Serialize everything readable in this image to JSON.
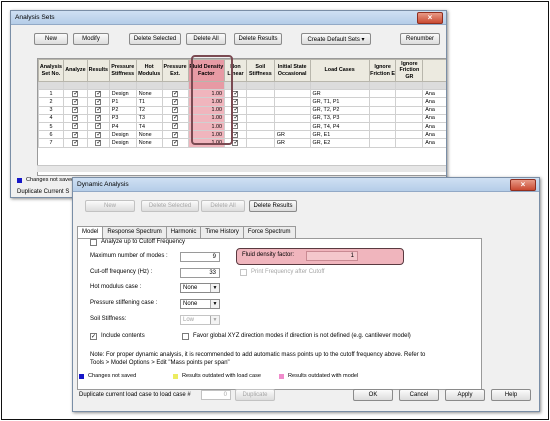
{
  "analysis_sets": {
    "title": "Analysis Sets",
    "close_symbol": "×",
    "toolbar": {
      "new": "New",
      "modify": "Modify",
      "delete_selected": "Delete Selected",
      "delete_all": "Delete All",
      "delete_results": "Delete Results",
      "create_default_sets": "Create Default Sets ▾",
      "renumber": "Renumber"
    },
    "columns": [
      "Analysis Set No.",
      "Analyze",
      "Results",
      "Pressure Stiffness",
      "Hot Modulus",
      "Pressure Ext.",
      "Fluid Density Factor",
      "Non Linear",
      "Soil Stiffness",
      "Initial State Occasional",
      "Load Cases",
      "Ignore Friction E",
      "Ignore Friction GR",
      ""
    ],
    "rows": [
      [
        "1",
        "✓",
        "✓",
        "Design",
        "None",
        "✓",
        "1.00",
        "✓",
        "",
        "",
        "GR",
        "",
        "",
        "Ana"
      ],
      [
        "2",
        "✓",
        "✓",
        "P1",
        "T1",
        "✓",
        "1.00",
        "✓",
        "",
        "",
        "GR, T1, P1",
        "",
        "",
        "Ana"
      ],
      [
        "3",
        "✓",
        "✓",
        "P2",
        "T2",
        "✓",
        "1.00",
        "✓",
        "",
        "",
        "GR, T2, P2",
        "",
        "",
        "Ana"
      ],
      [
        "4",
        "✓",
        "✓",
        "P3",
        "T3",
        "✓",
        "1.00",
        "✓",
        "",
        "",
        "GR, T3, P3",
        "",
        "",
        "Ana"
      ],
      [
        "5",
        "✓",
        "✓",
        "P4",
        "T4",
        "✓",
        "1.00",
        "✓",
        "",
        "",
        "GR, T4, P4",
        "",
        "",
        "Ana"
      ],
      [
        "6",
        "✓",
        "✓",
        "Design",
        "None",
        "✓",
        "1.00",
        "✓",
        "",
        "GR",
        "GR, E1",
        "",
        "",
        "Ana"
      ],
      [
        "7",
        "✓",
        "✓",
        "Design",
        "None",
        "✓",
        "1.00",
        "✓",
        "",
        "GR",
        "GR, E2",
        "",
        "",
        "Ana"
      ]
    ],
    "legend_changes": "Changes not saved",
    "duplicate_label": "Duplicate Current S"
  },
  "dynamic_analysis": {
    "title": "Dynamic Analysis",
    "close_symbol": "×",
    "toolbar": {
      "new": "New",
      "delete_selected": "Delete Selected",
      "delete_all": "Delete All",
      "delete_results": "Delete Results"
    },
    "tabs": [
      "Model",
      "Response Spectrum",
      "Harmonic",
      "Time History",
      "Force Spectrum"
    ],
    "analyze_cutoff": "Analyze up to Cutoff Frequency",
    "max_modes_label": "Maximum number of modes :",
    "max_modes_value": "9",
    "cutoff_label": "Cut-off frequency (Hz) :",
    "cutoff_value": "33",
    "fluid_density_label": "Fluid density factor:",
    "fluid_density_value": "1",
    "print_frequency": "Print Frequency after Cutoff",
    "hot_modulus_label": "Hot modulus case :",
    "hot_modulus_value": "None",
    "pressure_stiffening_label": "Pressure stiffening case :",
    "pressure_stiffening_value": "None",
    "soil_stiffness_label": "Soil Stiffness:",
    "soil_stiffness_value": "Low",
    "include_contents": "Include contents",
    "favor_xyz": "Favor global XYZ direction modes if direction is not defined (e.g. cantilever model)",
    "note": "Note: For proper dynamic analysis, it is recommended to add automatic mass points up to the cutoff frequency above.  Refer to Tools > Model Options > Edit \"Mass points per span\"",
    "legend": {
      "changes": "Changes not saved",
      "outdated_load": "Results outdated with load case",
      "outdated_model": "Results outdated with model"
    },
    "duplicate_label": "Duplicate current load case to load case #",
    "duplicate_value": "0",
    "duplicate_button": "Duplicate",
    "ok": "OK",
    "cancel": "Cancel",
    "apply": "Apply",
    "help": "Help"
  },
  "colors": {
    "highlight": "#f0b5bd",
    "changes_not_saved": "#1616c8",
    "outdated_load": "#ecec60",
    "outdated_model": "#f08ccc"
  }
}
